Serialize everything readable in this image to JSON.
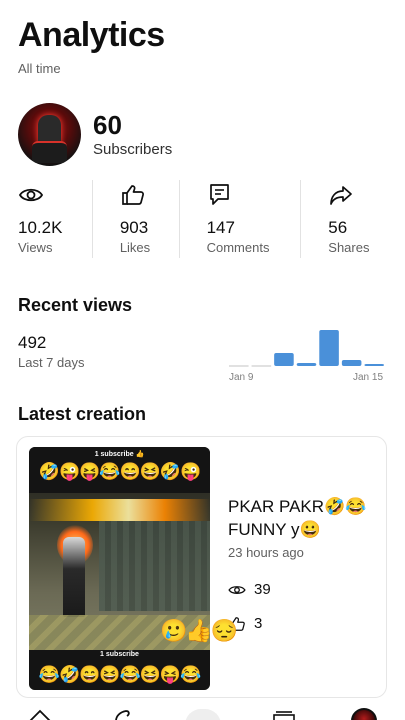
{
  "header": {
    "title": "Analytics",
    "subtitle": "All time"
  },
  "channel": {
    "subscribers": "60",
    "subscribers_label": "Subscribers"
  },
  "stats": [
    {
      "icon": "eye-icon",
      "value": "10.2K",
      "label": "Views"
    },
    {
      "icon": "thumbs-up-icon",
      "value": "903",
      "label": "Likes"
    },
    {
      "icon": "comment-icon",
      "value": "147",
      "label": "Comments"
    },
    {
      "icon": "share-icon",
      "value": "56",
      "label": "Shares"
    }
  ],
  "recent": {
    "title": "Recent views",
    "value": "492",
    "label": "Last 7 days",
    "chart_start": "Jan 9",
    "chart_end": "Jan 15",
    "bars": [
      0,
      0,
      13,
      3,
      36,
      6,
      2
    ],
    "accent": "#4a90d9"
  },
  "latest": {
    "title": "Latest creation",
    "thumb_subscribe": "1 subscribe 👍",
    "thumb_subscribe_bottom": "1 subscribe",
    "thumb_emojis_top": "🤣😜😝😂😄😆🤣😜",
    "thumb_emojis_bottom": "😂🤣😄😆😂😆😝😂",
    "video_title": "PKAR PAKR🤣😂 FUNNY y😀",
    "time": "23 hours ago",
    "views": "39",
    "likes": "3",
    "overlay": "🥲👍😔"
  }
}
